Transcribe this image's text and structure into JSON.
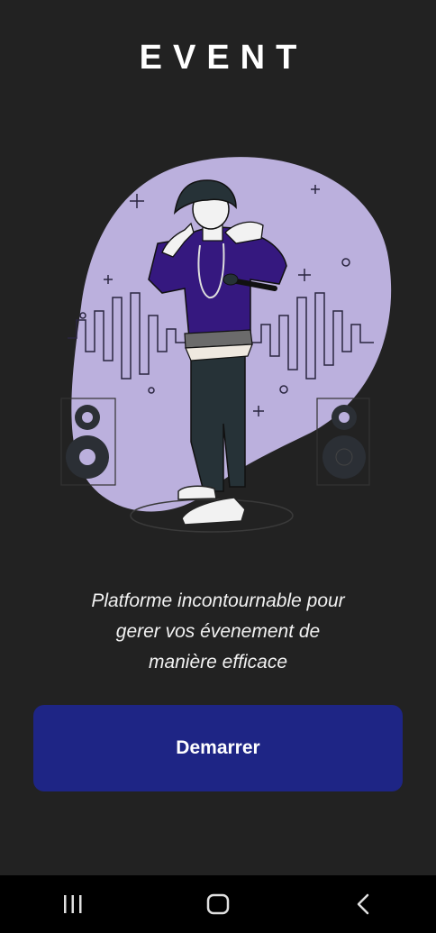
{
  "header": {
    "title": "EVENT"
  },
  "illustration": {
    "name": "rapper-with-microphone-illustration",
    "blob_color": "#bbb0dd",
    "jacket_color": "#35187f"
  },
  "tagline": {
    "line1": "Platforme incontournable pour",
    "line2": "gerer vos évenement de",
    "line3": "manière efficace"
  },
  "cta": {
    "label": "Demarrer",
    "color": "#1e2585"
  },
  "navbar": {
    "icons": [
      "recent-apps-icon",
      "home-icon",
      "back-icon"
    ]
  }
}
